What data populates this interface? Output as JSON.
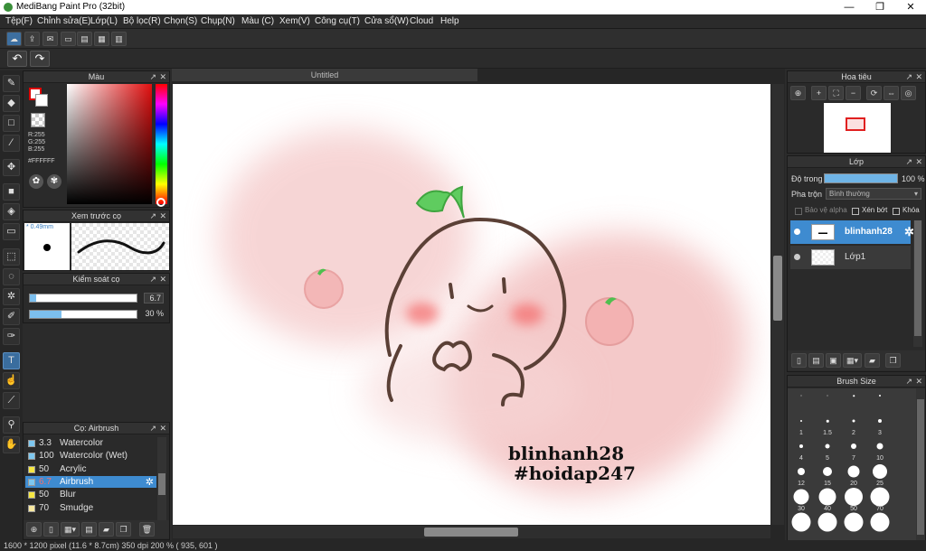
{
  "window": {
    "title": "MediBang Paint Pro (32bit)",
    "min": "—",
    "max": "❐",
    "close": "✕"
  },
  "menu": [
    "Tệp(F)",
    "Chỉnh sửa(E)",
    "Lớp(L)",
    "Bộ lọc(R)",
    "Chọn(S)",
    "Chụp(N)",
    "Màu (C)",
    "Xem(V)",
    "Công cụ(T)",
    "Cửa sổ(W)",
    "Cloud",
    "Help"
  ],
  "toolbar": {
    "undo": "↶",
    "redo": "↷"
  },
  "colors": {
    "accent": "#3e8bd0",
    "primary_color": "#ffffff",
    "panel_bg": "#2a2a2a"
  },
  "color_panel": {
    "title": "Màu",
    "r": "R:255",
    "g": "G:255",
    "b": "B:255",
    "hex": "#FFFFFF"
  },
  "brush_preview": {
    "title": "Xem trước cọ",
    "size": "* 0.49mm"
  },
  "brush_control": {
    "title": "Kiểm soát cọ",
    "size_value": "6.7",
    "size_fraction": 0.06,
    "opacity_value": "30 %",
    "opacity_fraction": 0.3
  },
  "brush_list": {
    "title": "Cọ: Airbrush",
    "items": [
      {
        "size": "3.3",
        "name": "Watercolor",
        "color": "#7ec8f0"
      },
      {
        "size": "100",
        "name": "Watercolor (Wet)",
        "color": "#7ec8f0"
      },
      {
        "size": "50",
        "name": "Acrylic",
        "color": "#f5e642"
      },
      {
        "size": "6.7",
        "name": "Airbrush",
        "color": "#7ec8f0",
        "selected": true
      },
      {
        "size": "50",
        "name": "Blur",
        "color": "#f5e642"
      },
      {
        "size": "70",
        "name": "Smudge",
        "color": "#f8e8a0"
      }
    ]
  },
  "document": {
    "tab": "Untitled",
    "watermark_line1": "blinhanh28",
    "watermark_line2": "#hoidap247"
  },
  "navigator": {
    "title": "Hoa tiêu"
  },
  "layers": {
    "title": "Lớp",
    "opacity_label": "Độ trong",
    "opacity_value": "100 %",
    "blend_label": "Pha trộn",
    "blend_value": "Bình thường",
    "protect_alpha": "Bảo vệ alpha",
    "clipping": "Xén bớt",
    "lock": "Khóa",
    "items": [
      {
        "name": "blinhanh28",
        "selected": true
      },
      {
        "name": "Lớp1",
        "selected": false
      }
    ]
  },
  "brush_size": {
    "title": "Brush Size",
    "sizes": [
      "",
      "",
      "",
      "",
      "1",
      "1.5",
      "2",
      "3",
      "4",
      "5",
      "7",
      "10",
      "12",
      "15",
      "20",
      "25",
      "30",
      "40",
      "50",
      "70",
      "",
      "",
      "",
      ""
    ]
  },
  "status": "1600 * 1200 pixel  (11.6 * 8.7cm)  350 dpi  200 %  ( 935, 601 )"
}
